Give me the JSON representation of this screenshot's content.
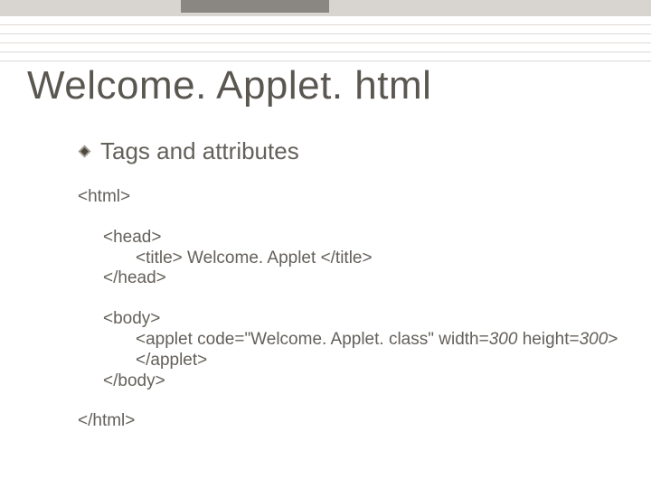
{
  "title": "Welcome. Applet. html",
  "subtitle": "Tags and attributes",
  "code": {
    "html_open": "<html>",
    "head_open": "<head>",
    "title_open": "<title> ",
    "title_text": "Welcome. Applet ",
    "title_close": "</title>",
    "head_close": "</head>",
    "body_open": "<body>",
    "applet_open_pre": "<applet code=\"Welcome. Applet. class\" width=",
    "applet_width": "300",
    "applet_mid": " height=",
    "applet_height": "300",
    "applet_open_post": ">",
    "applet_close": "</applet>",
    "body_close": "</body>",
    "html_close": "</html>"
  }
}
